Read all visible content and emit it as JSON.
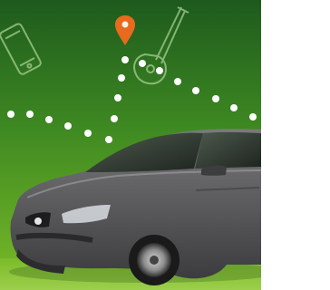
{
  "scene": {
    "subject": "car-ad-visual",
    "icons": [
      "map-pin-icon",
      "guitar-icon",
      "phone-icon"
    ],
    "colors": {
      "background_top": "#1f5a1c",
      "background_bottom": "#77b826",
      "pin": "#e86a1d",
      "dots": "#ffffff",
      "car_body": "#5f5f62",
      "car_dark": "#2a2a2c",
      "blank_panel": "#ffffff"
    }
  }
}
